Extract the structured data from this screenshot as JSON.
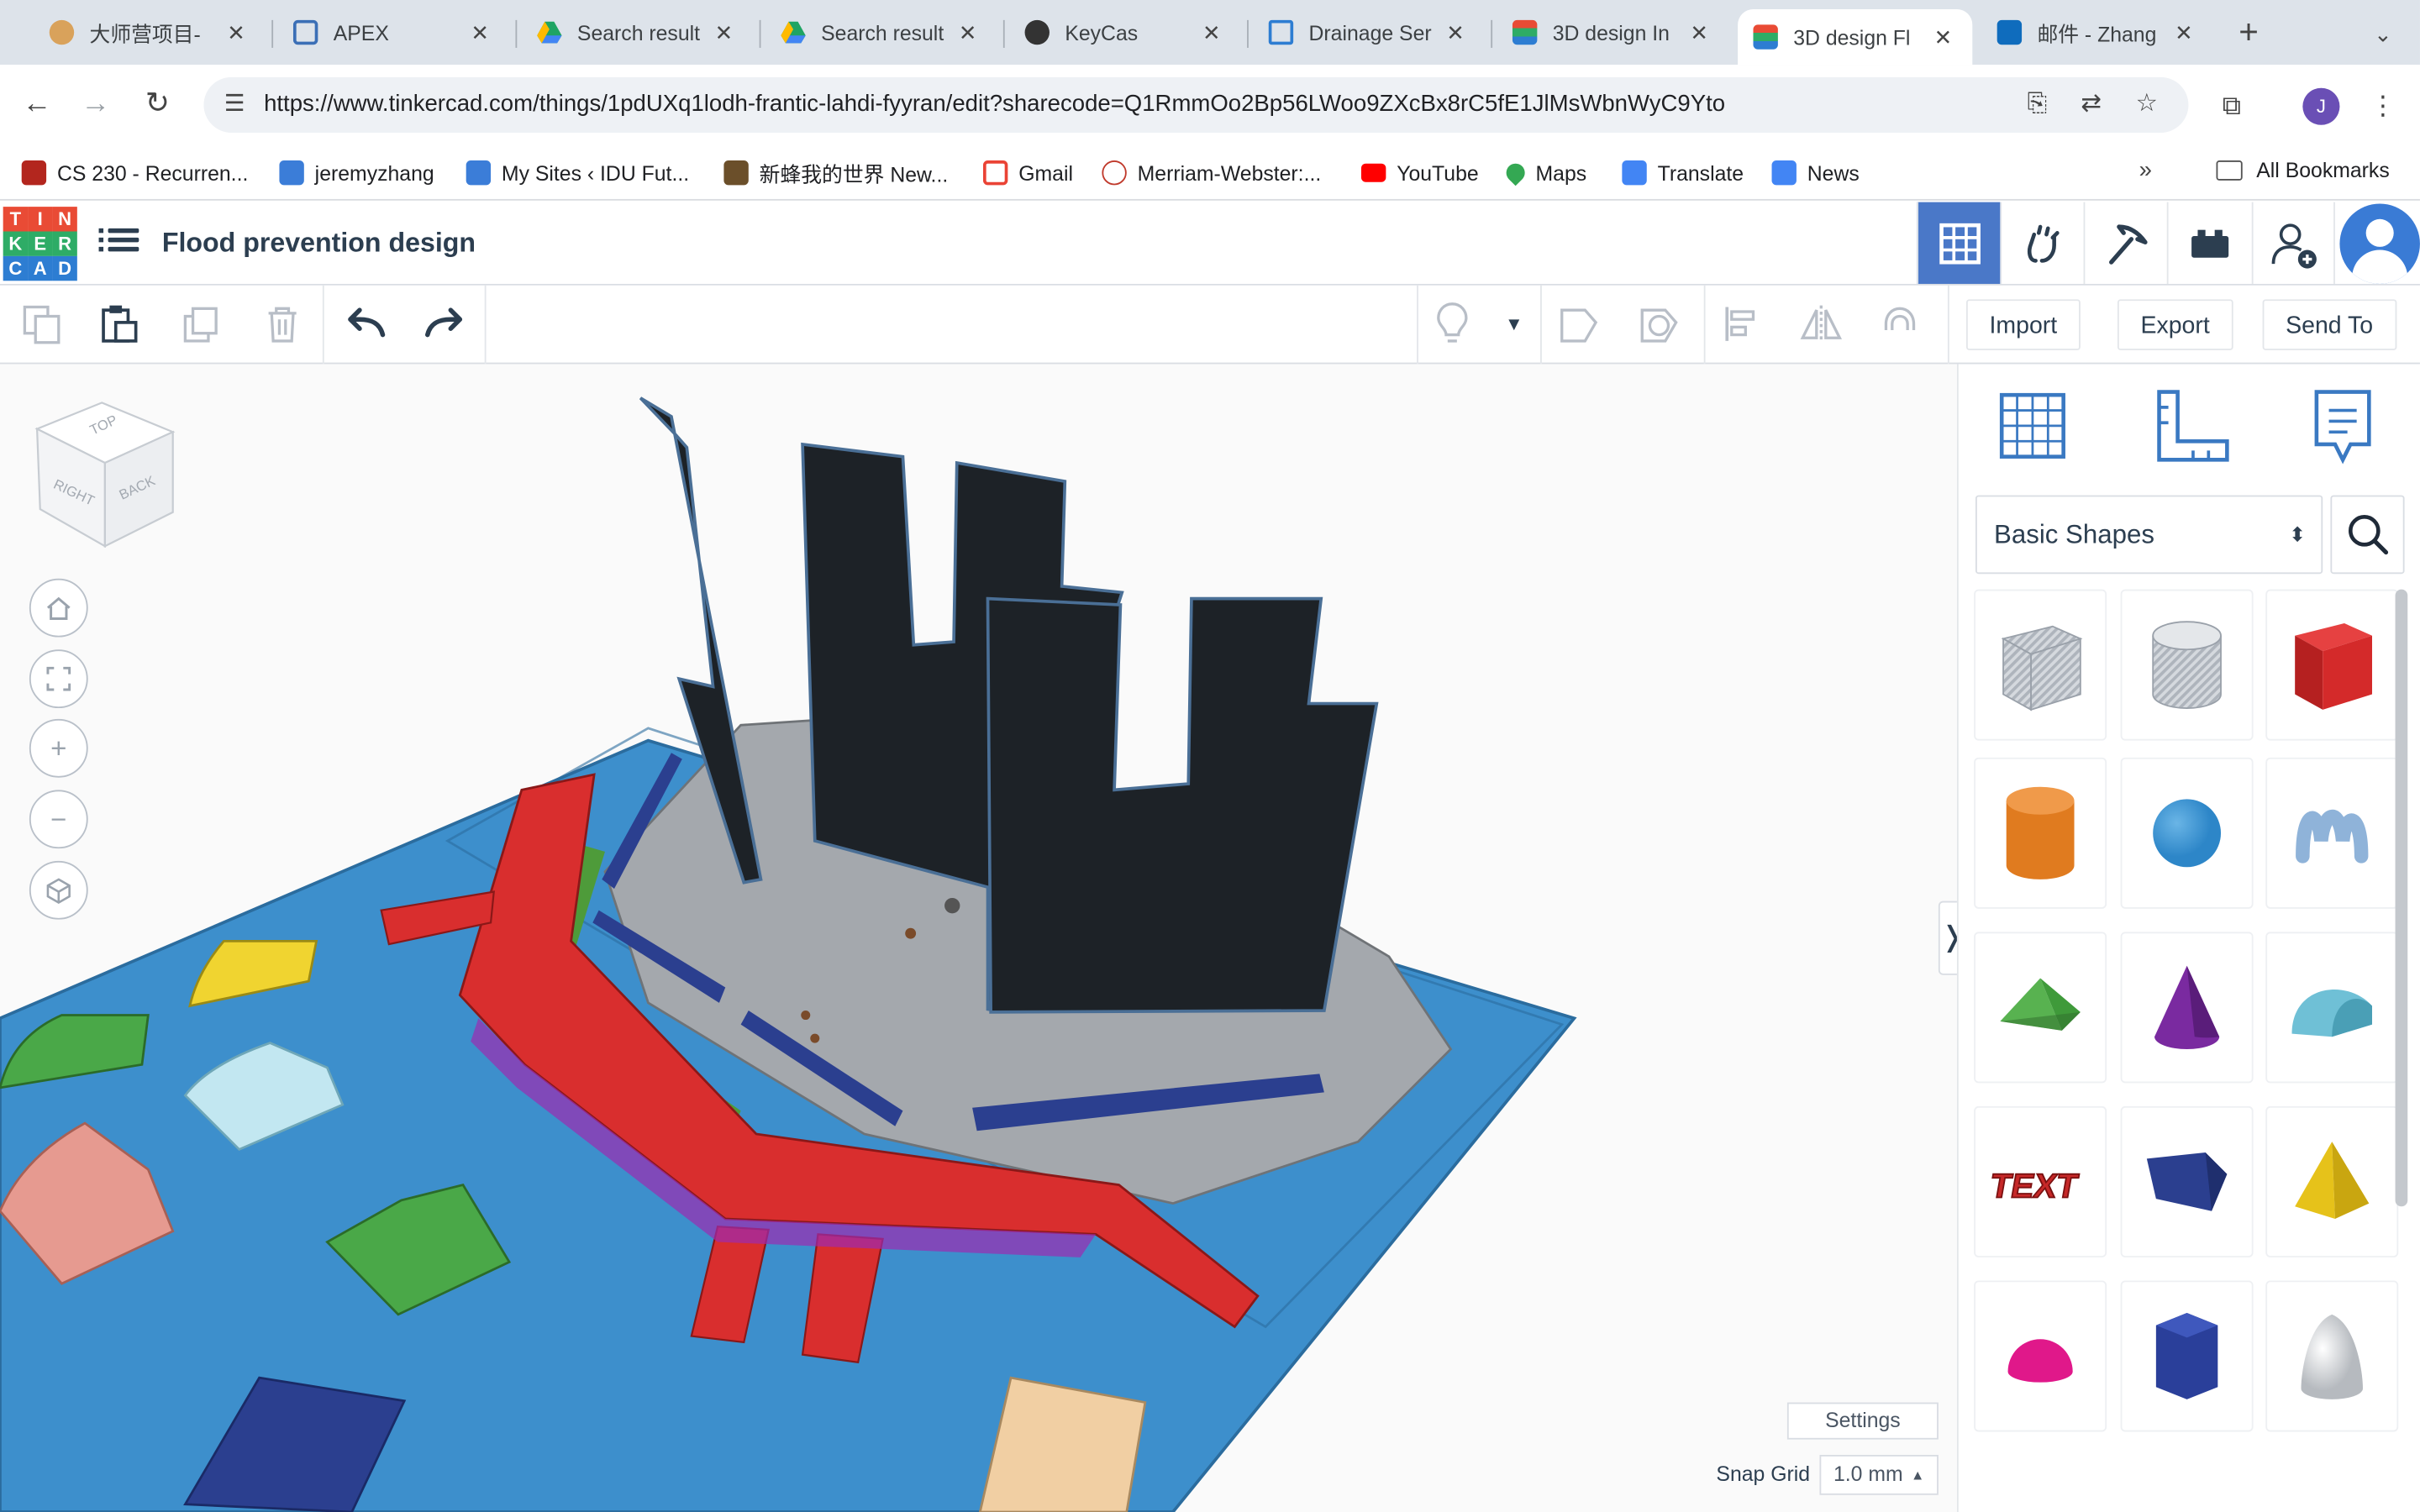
{
  "browser": {
    "tabs": [
      {
        "title": "大师营项目-",
        "icon": "globe-icon",
        "color": "#c0392b"
      },
      {
        "title": "APEX",
        "icon": "apex-icon",
        "color": "#3b6fb6"
      },
      {
        "title": "Search result",
        "icon": "google-drive-icon",
        "color": "#1fa463"
      },
      {
        "title": "Search result",
        "icon": "google-drive-icon",
        "color": "#1fa463"
      },
      {
        "title": "KeyCas",
        "icon": "keycas-icon",
        "color": "#333333"
      },
      {
        "title": "Drainage Ser",
        "icon": "doc-icon",
        "color": "#2d7dd2"
      },
      {
        "title": "3D design In",
        "icon": "tinkercad-icon",
        "color": "#e94b35"
      },
      {
        "title": "3D design Fl",
        "icon": "tinkercad-icon",
        "color": "#e94b35"
      },
      {
        "title": "邮件 - Zhang",
        "icon": "outlook-icon",
        "color": "#0f6cbd"
      }
    ],
    "url": "https://www.tinkercad.com/things/1pdUXq1lodh-frantic-lahdi-fyyran/edit?sharecode=Q1RmmOo2Bp56LWoo9ZXcBx8rC5fE1JlMsWbnWyC9Yto",
    "profile_initial": "J",
    "bookmarks": [
      {
        "label": "CS 230 - Recurren...",
        "color": "#b3261e"
      },
      {
        "label": "jeremyzhang",
        "color": "#3b7dd8"
      },
      {
        "label": "My Sites ‹ IDU Fut...",
        "color": "#3b7dd8"
      },
      {
        "label": "新蜂我的世界 New...",
        "color": "#6b4f2a"
      },
      {
        "label": "Gmail",
        "color": "#ea4335"
      },
      {
        "label": "Merriam-Webster:...",
        "color": "#c0392b"
      },
      {
        "label": "YouTube",
        "color": "#ff0000"
      },
      {
        "label": "Maps",
        "color": "#34a853"
      },
      {
        "label": "Translate",
        "color": "#4285f4"
      },
      {
        "label": "News",
        "color": "#4285f4"
      }
    ],
    "more_bookmarks": "»",
    "all_bookmarks": "All Bookmarks"
  },
  "app": {
    "logo_letters": [
      "T",
      "I",
      "N",
      "K",
      "E",
      "R",
      "C",
      "A",
      "D"
    ],
    "logo_colors": [
      "#e94b35",
      "#e94b35",
      "#e94b35",
      "#2eac66",
      "#2eac66",
      "#2eac66",
      "#2d7dd2",
      "#2d7dd2",
      "#2d7dd2"
    ],
    "title": "Flood prevention design",
    "header_buttons": [
      "grid-view-icon",
      "sim-lab-icon",
      "minecraft-pickaxe-icon",
      "bricks-icon",
      "invite-user-icon"
    ],
    "toolbar_right": {
      "import": "Import",
      "export": "Export",
      "send_to": "Send To"
    },
    "viewcube": {
      "top": "TOP",
      "right": "RIGHT",
      "back": "BACK"
    }
  },
  "panel": {
    "library": "Basic Shapes",
    "shapes": [
      {
        "name": "box-hole",
        "color": "#c8ccd2"
      },
      {
        "name": "cylinder-hole",
        "color": "#c8ccd2"
      },
      {
        "name": "box",
        "color": "#d42a2a"
      },
      {
        "name": "cylinder",
        "color": "#e07b1f"
      },
      {
        "name": "sphere",
        "color": "#2d86c8"
      },
      {
        "name": "scribble",
        "color": "#8fb3d9"
      },
      {
        "name": "roof",
        "color": "#3f9a3a"
      },
      {
        "name": "cone",
        "color": "#7a2aa0"
      },
      {
        "name": "round-roof",
        "color": "#6fc0d6"
      },
      {
        "name": "text",
        "color": "#c62828"
      },
      {
        "name": "half-box",
        "color": "#2b3f8f"
      },
      {
        "name": "pyramid",
        "color": "#e6c21a"
      },
      {
        "name": "half-sphere",
        "color": "#e0188a"
      },
      {
        "name": "polygon",
        "color": "#2a3f9a"
      },
      {
        "name": "paraboloid",
        "color": "#d8dadd"
      }
    ],
    "text_shape_label": "TEXT"
  },
  "workplane": {
    "settings": "Settings",
    "snap_label": "Snap Grid",
    "snap_value": "1.0 mm"
  }
}
